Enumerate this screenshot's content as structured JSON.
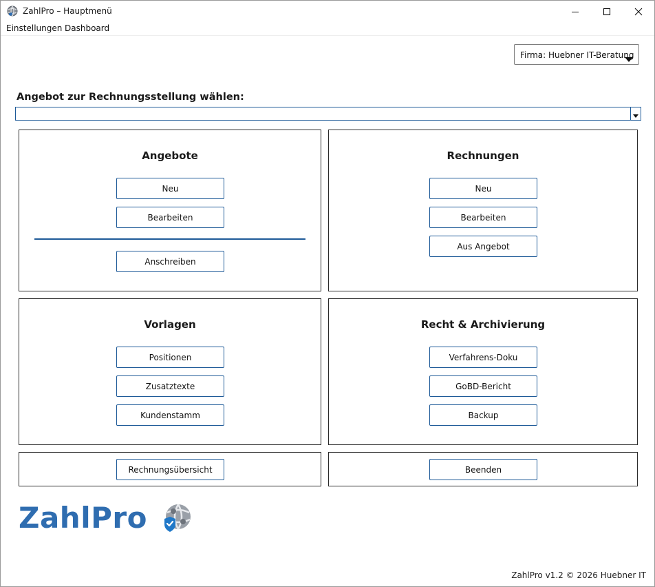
{
  "window": {
    "title": "ZahlPro – Hauptmenü"
  },
  "menu": {
    "items": [
      {
        "label": "Einstellungen"
      },
      {
        "label": "Dashboard"
      }
    ]
  },
  "firma_select": {
    "value": "Firma: Huebner IT-Beratung"
  },
  "offer_select": {
    "label": "Angebot zur Rechnungsstellung wählen:",
    "value": ""
  },
  "panels": {
    "angebote": {
      "title": "Angebote",
      "buttons": [
        "Neu",
        "Bearbeiten",
        "Anschreiben"
      ]
    },
    "rechnungen": {
      "title": "Rechnungen",
      "buttons": [
        "Neu",
        "Bearbeiten",
        "Aus Angebot"
      ]
    },
    "vorlagen": {
      "title": "Vorlagen",
      "buttons": [
        "Positionen",
        "Zusatztexte",
        "Kundenstamm"
      ]
    },
    "recht": {
      "title": "Recht & Archivierung",
      "buttons": [
        "Verfahrens-Doku",
        "GoBD-Bericht",
        "Backup"
      ]
    }
  },
  "bottom": {
    "overview_button": "Rechnungsübersicht",
    "exit_button": "Beenden"
  },
  "logo": {
    "text": "ZahlPro"
  },
  "footer": {
    "text": "ZahlPro v1.2 © 2026 Huebner IT"
  },
  "colors": {
    "accent": "#1e5a98",
    "logo_blue": "#2f6db0",
    "panel_border": "#2b2b2b"
  },
  "icons": [
    "app-globe-icon",
    "minimize-icon",
    "maximize-icon",
    "close-icon",
    "dropdown-arrow-icon",
    "shield-check-icon"
  ]
}
